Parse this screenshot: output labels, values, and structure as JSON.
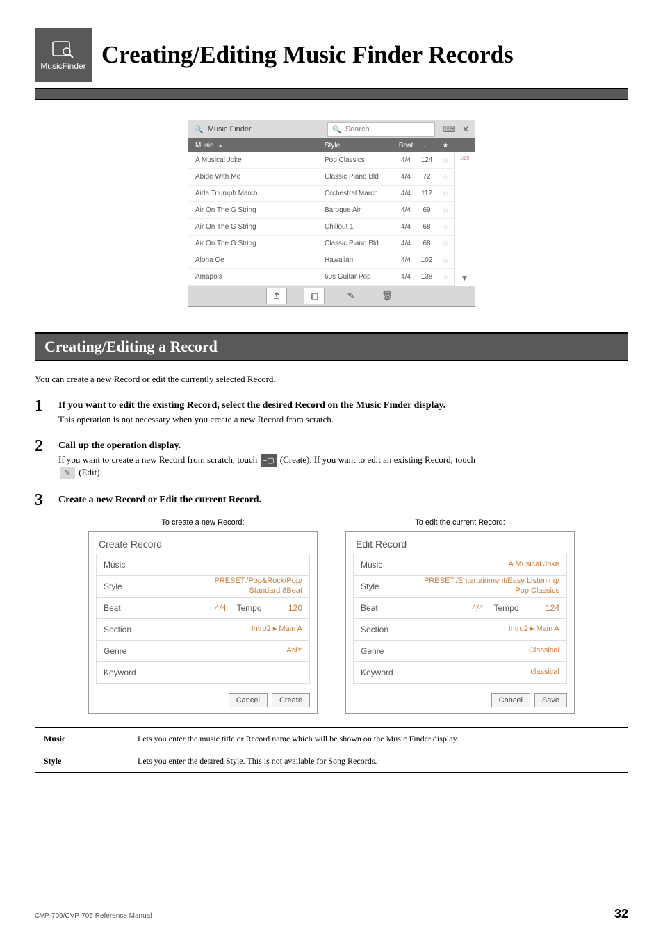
{
  "header": {
    "badge_label": "MusicFinder",
    "page_title": "Creating/Editing Music Finder Records"
  },
  "finder": {
    "title": "Music Finder",
    "search_placeholder": "Search",
    "columns": {
      "music": "Music",
      "style": "Style",
      "beat": "Beat",
      "tempo": "♩",
      "star": "★"
    },
    "page_indicator": "1/29",
    "rows": [
      {
        "music": "A Musical Joke",
        "style": "Pop Classics",
        "beat": "4/4",
        "tempo": "124"
      },
      {
        "music": "Abide With Me",
        "style": "Classic Piano Bld",
        "beat": "4/4",
        "tempo": "72"
      },
      {
        "music": "Aida Triumph March",
        "style": "Orchestral March",
        "beat": "4/4",
        "tempo": "112"
      },
      {
        "music": "Air On The G String",
        "style": "Baroque Air",
        "beat": "4/4",
        "tempo": "69"
      },
      {
        "music": "Air On The G String",
        "style": "Chillout 1",
        "beat": "4/4",
        "tempo": "68"
      },
      {
        "music": "Air On The G String",
        "style": "Classic Piano Bld",
        "beat": "4/4",
        "tempo": "68"
      },
      {
        "music": "Aloha Oe",
        "style": "Hawaiian",
        "beat": "4/4",
        "tempo": "102"
      },
      {
        "music": "Amapola",
        "style": "60s Guitar Pop",
        "beat": "4/4",
        "tempo": "138"
      }
    ]
  },
  "section_title": "Creating/Editing a Record",
  "intro_text": "You can create a new Record or edit the currently selected Record.",
  "steps": {
    "s1_strong": "If you want to edit the existing Record, select the desired Record on the Music Finder display.",
    "s1_body": "This operation is not necessary when you create a new Record from scratch.",
    "s2_strong": "Call up the operation display.",
    "s2_body_a": "If you want to create a new Record from scratch, touch ",
    "s2_body_b": " (Create). If you want to edit an existing Record, touch ",
    "s2_body_c": " (Edit).",
    "s3_strong": "Create a new Record or Edit the current Record."
  },
  "dialogs": {
    "create_caption": "To create a new Record:",
    "edit_caption": "To edit the current Record:",
    "create": {
      "title": "Create Record",
      "music_label": "Music",
      "music_val": "",
      "style_label": "Style",
      "style_val": "PRESET:/Pop&Rock/Pop/\nStandard 8Beat",
      "beat_label": "Beat",
      "beat_val": "4/4",
      "tempo_label": "Tempo",
      "tempo_val": "120",
      "section_label": "Section",
      "section_val": "Intro2   ▸ Main A",
      "genre_label": "Genre",
      "genre_val": "ANY",
      "keyword_label": "Keyword",
      "keyword_val": "",
      "cancel": "Cancel",
      "ok": "Create"
    },
    "edit": {
      "title": "Edit Record",
      "music_label": "Music",
      "music_val": "A Musical Joke",
      "style_label": "Style",
      "style_val": "PRESET:/Entertainment/Easy Listening/\nPop Classics",
      "beat_label": "Beat",
      "beat_val": "4/4",
      "tempo_label": "Tempo",
      "tempo_val": "124",
      "section_label": "Section",
      "section_val": "Intro2   ▸ Main A",
      "genre_label": "Genre",
      "genre_val": "Classical",
      "keyword_label": "Keyword",
      "keyword_val": "classical",
      "cancel": "Cancel",
      "ok": "Save"
    }
  },
  "defs": {
    "music_label": "Music",
    "music_text": "Lets you enter the music title or Record name which will be shown on the Music Finder display.",
    "style_label": "Style",
    "style_text": "Lets you enter the desired Style. This is not available for Song Records."
  },
  "footer": {
    "ref": "CVP-709/CVP-705 Reference Manual",
    "page": "32"
  }
}
